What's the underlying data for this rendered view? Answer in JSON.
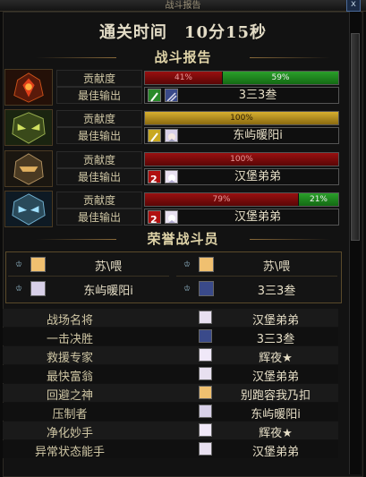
{
  "window": {
    "title": "战斗报告",
    "close_glyph": "x"
  },
  "clear_time": "通关时间　10分15秒",
  "battle_report_title": "战斗报告",
  "honor_title": "荣誉战斗员",
  "labels": {
    "contribution": "贡献度",
    "best_output": "最佳输出"
  },
  "entries": [
    {
      "contrib": {
        "red_pct": 41,
        "red_text": "41%",
        "green_pct": 59,
        "green_text": "59%",
        "gold_pct": 0,
        "gold_text": ""
      },
      "weapon_color": "#2a8a2a",
      "best_output": "3三3叁"
    },
    {
      "contrib": {
        "red_pct": 0,
        "red_text": "",
        "green_pct": 0,
        "green_text": "",
        "gold_pct": 100,
        "gold_text": "100%"
      },
      "weapon_color": "#c8a820",
      "best_output": "东屿暖阳i"
    },
    {
      "contrib": {
        "red_pct": 100,
        "red_text": "100%",
        "green_pct": 0,
        "green_text": "",
        "gold_pct": 0,
        "gold_text": ""
      },
      "weapon_color": "#b01010",
      "best_output": "汉堡弟弟"
    },
    {
      "contrib": {
        "red_pct": 79,
        "red_text": "79%",
        "green_pct": 21,
        "green_text": "21%",
        "gold_pct": 0,
        "gold_text": ""
      },
      "weapon_color": "#b01010",
      "best_output": "汉堡弟弟"
    }
  ],
  "honor": [
    "苏\\喂",
    "苏\\喂",
    "东屿暖阳i",
    "3三3叁"
  ],
  "awards": [
    {
      "title": "战场名将",
      "player": "汉堡弟弟"
    },
    {
      "title": "一击决胜",
      "player": "3三3叁"
    },
    {
      "title": "救援专家",
      "player": "辉夜★"
    },
    {
      "title": "最快富翁",
      "player": "汉堡弟弟"
    },
    {
      "title": "回避之神",
      "player": "别跑容我乃扣"
    },
    {
      "title": "压制者",
      "player": "东屿暖阳i"
    },
    {
      "title": "净化妙手",
      "player": "辉夜★"
    },
    {
      "title": "异常状态能手",
      "player": "汉堡弟弟"
    }
  ]
}
